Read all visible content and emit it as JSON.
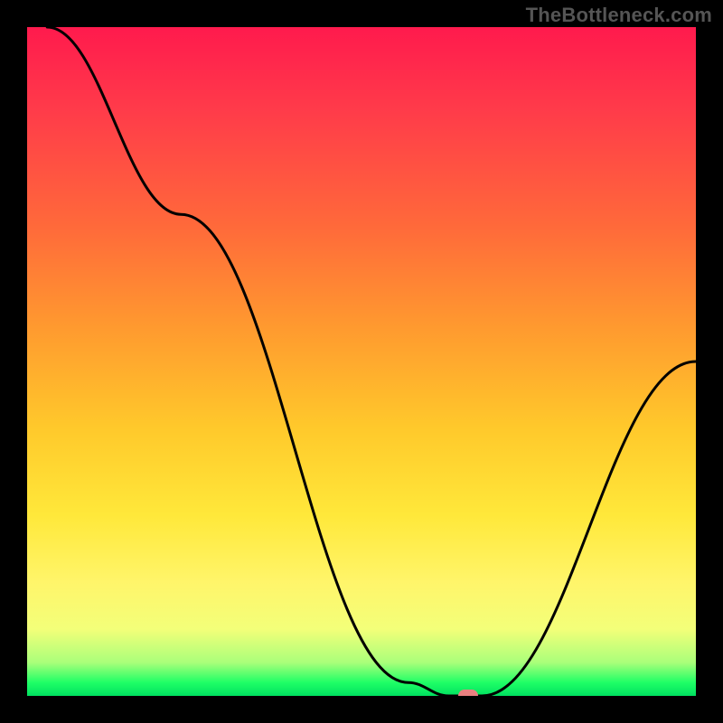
{
  "watermark_text": "TheBottleneck.com",
  "chart_data": {
    "type": "line",
    "title": "",
    "xlabel": "",
    "ylabel": "",
    "xlim": [
      0,
      100
    ],
    "ylim": [
      0,
      100
    ],
    "x": [
      3,
      23,
      57,
      63,
      68,
      100
    ],
    "values": [
      100,
      72,
      2,
      0,
      0,
      50
    ],
    "marker": {
      "x": 66,
      "y": 0
    },
    "gradient_stops": [
      {
        "pos": 0,
        "color": "#ff1a4d"
      },
      {
        "pos": 12,
        "color": "#ff3a4a"
      },
      {
        "pos": 30,
        "color": "#ff6a3a"
      },
      {
        "pos": 45,
        "color": "#ff9a2f"
      },
      {
        "pos": 60,
        "color": "#ffc92b"
      },
      {
        "pos": 73,
        "color": "#ffe83a"
      },
      {
        "pos": 83,
        "color": "#fff56a"
      },
      {
        "pos": 90,
        "color": "#f3ff79"
      },
      {
        "pos": 95,
        "color": "#aaff7a"
      },
      {
        "pos": 98,
        "color": "#1fff66"
      },
      {
        "pos": 100,
        "color": "#00e060"
      }
    ],
    "curve_stroke": "#000000",
    "curve_width": 3,
    "marker_color": "#e98080"
  }
}
